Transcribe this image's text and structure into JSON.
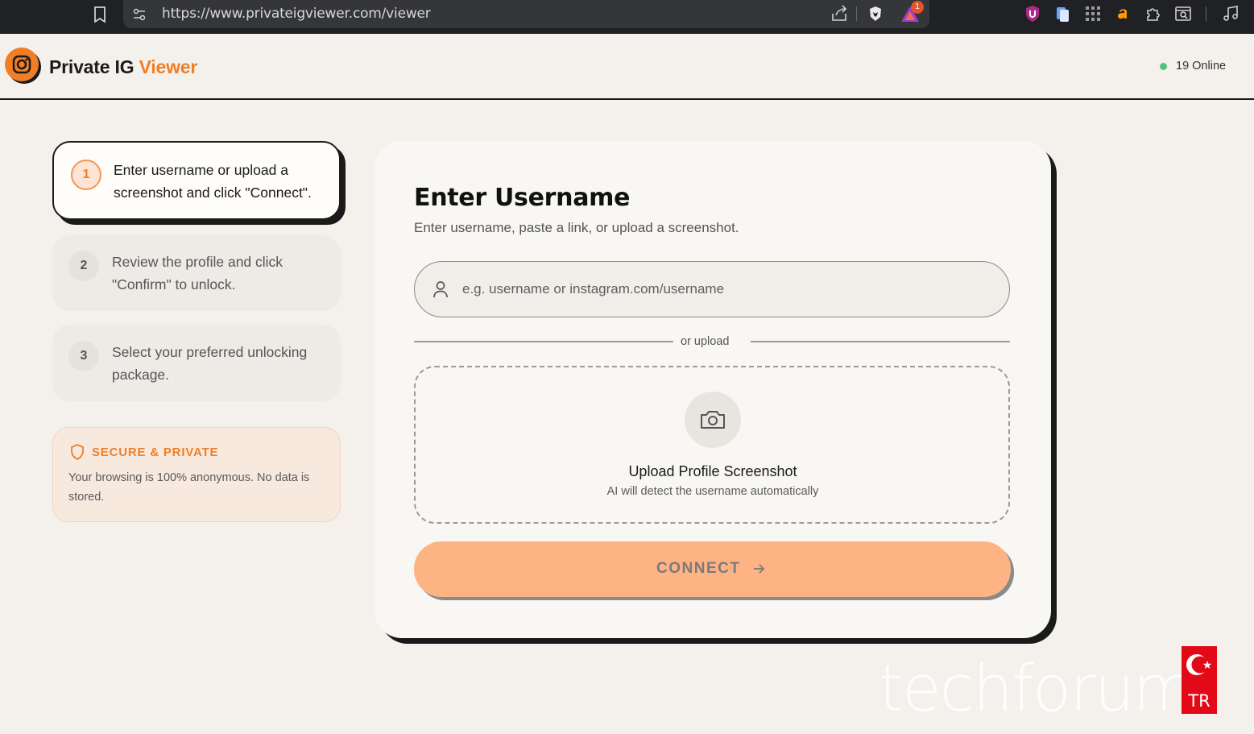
{
  "browser": {
    "url": "https://www.privateigviewer.com/viewer",
    "notification_count": "1"
  },
  "header": {
    "logo_primary": "Private IG ",
    "logo_accent": "Viewer",
    "online_status": "19 Online"
  },
  "steps": [
    {
      "number": "1",
      "text": "Enter username or upload a screenshot and click \"Connect\"."
    },
    {
      "number": "2",
      "text": "Review the profile and click \"Confirm\" to unlock."
    },
    {
      "number": "3",
      "text": "Select your preferred unlocking package."
    }
  ],
  "secure": {
    "title": "SECURE & PRIVATE",
    "description": "Your browsing is 100% anonymous. No data is stored."
  },
  "card": {
    "title": "Enter Username",
    "subtitle": "Enter username, paste a link, or upload a screenshot.",
    "input_placeholder": "e.g. username or instagram.com/username",
    "input_value": "",
    "divider": "or upload",
    "upload_title": "Upload Profile Screenshot",
    "upload_desc": "AI will detect the username automatically",
    "connect_label": "CONNECT"
  },
  "watermark": {
    "text": "techforum",
    "flag_label": "TR"
  },
  "colors": {
    "accent": "#f07e26",
    "connect_bg": "#feb384",
    "online": "#4fc37a",
    "background": "#f4f1ec"
  }
}
